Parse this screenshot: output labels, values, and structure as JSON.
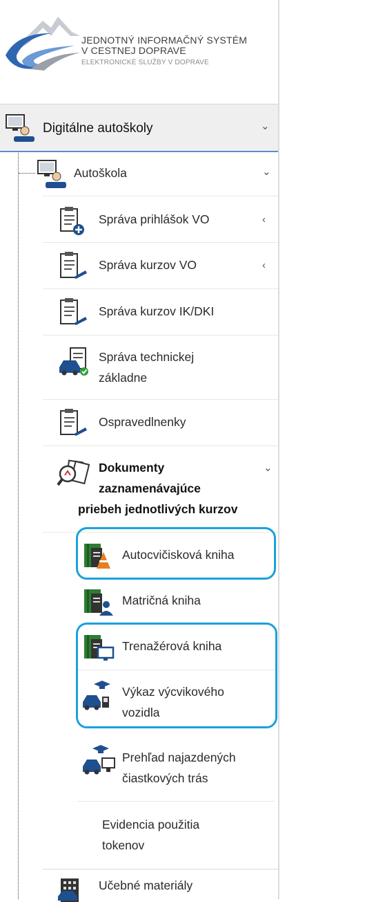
{
  "logo": {
    "line1": "JEDNOTNÝ INFORMAČNÝ SYSTÉM",
    "line2": "V CESTNEJ DOPRAVE",
    "line3": "ELEKTRONICKÉ SLUŽBY V DOPRAVE"
  },
  "menu": {
    "top": {
      "label": "Digitálne autoškoly",
      "icon": "instructor-computer-icon",
      "state": "expanded"
    },
    "autoskola": {
      "label": "Autoškola",
      "icon": "instructor-computer-icon",
      "state": "expanded"
    },
    "items": [
      {
        "label": "Správa prihlášok VO",
        "icon": "clipboard-add-icon",
        "chevron": "‹"
      },
      {
        "label": "Správa kurzov VO",
        "icon": "clipboard-icon",
        "chevron": "‹"
      },
      {
        "label": "Správa kurzov IK/DKI",
        "icon": "clipboard-icon"
      },
      {
        "label_line1": "Správa technickej",
        "label_line2": "základne",
        "icon": "car-document-icon"
      },
      {
        "label": "Ospravedlnenky",
        "icon": "clipboard-icon"
      },
      {
        "label_line1": "Dokumenty",
        "label_line2": "zaznamenávajúce",
        "label_line3": "priebeh jednotlivých kurzov",
        "icon": "document-magnifier-icon",
        "chevron": "⌄"
      }
    ],
    "sub_items": [
      {
        "label": "Autocvičisková kniha",
        "icon": "book-cone-icon"
      },
      {
        "label": "Matričná kniha",
        "icon": "book-person-icon"
      },
      {
        "label": "Trenažérová kniha",
        "icon": "book-monitor-icon"
      },
      {
        "label_line1": "Výkaz výcvikového",
        "label_line2": "vozidla",
        "icon": "car-graduate-icon"
      },
      {
        "label_line1": "Prehľad najazdených",
        "label_line2": "čiastkových trás",
        "icon": "car-graduate-computer-icon"
      },
      {
        "label_line1": "Evidencia použitia",
        "label_line2": "tokenov"
      }
    ],
    "bottom": {
      "label": "Učebné materiály",
      "icon": "building-icon"
    }
  },
  "colors": {
    "highlight": "#1aa1dc",
    "active_border": "#5a8fc4",
    "accent_green": "#2e7d32",
    "accent_blue": "#1e4f8f"
  }
}
